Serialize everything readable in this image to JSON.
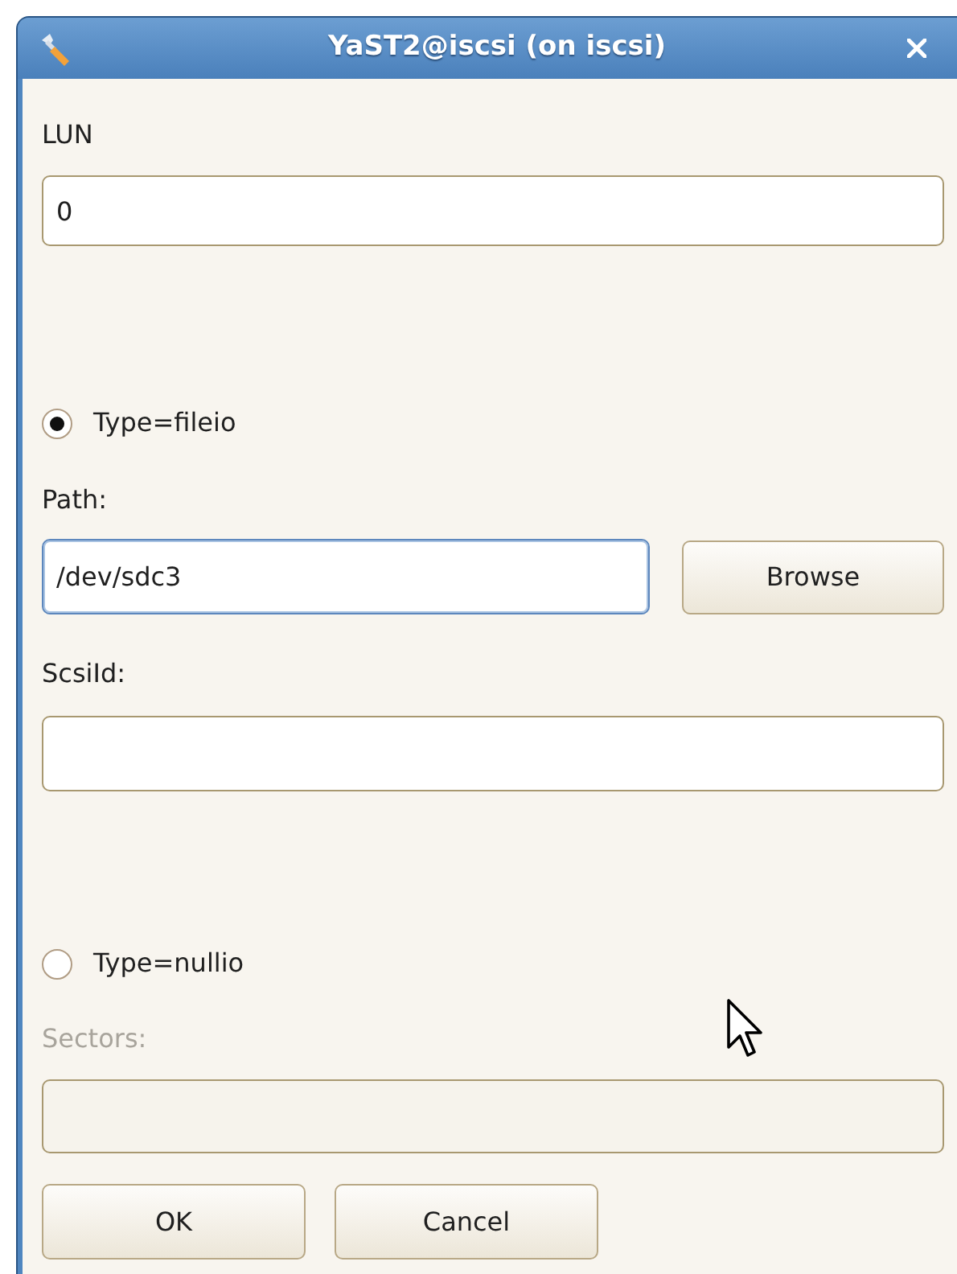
{
  "window": {
    "title": "YaST2@iscsi (on iscsi)"
  },
  "lun": {
    "label": "LUN",
    "value": "0"
  },
  "fileio": {
    "label": "Type=fileio",
    "selected": true,
    "path": {
      "label": "Path:",
      "value": "/dev/sdc3",
      "focused": true
    },
    "browse": "Browse",
    "scsi_id": {
      "label": "ScsiId:"
    }
  },
  "nullio": {
    "label": "Type=nullio",
    "selected": false,
    "sectors": {
      "label": "Sectors:",
      "disabled": true
    }
  },
  "buttons": [
    "OK",
    "Cancel"
  ]
}
